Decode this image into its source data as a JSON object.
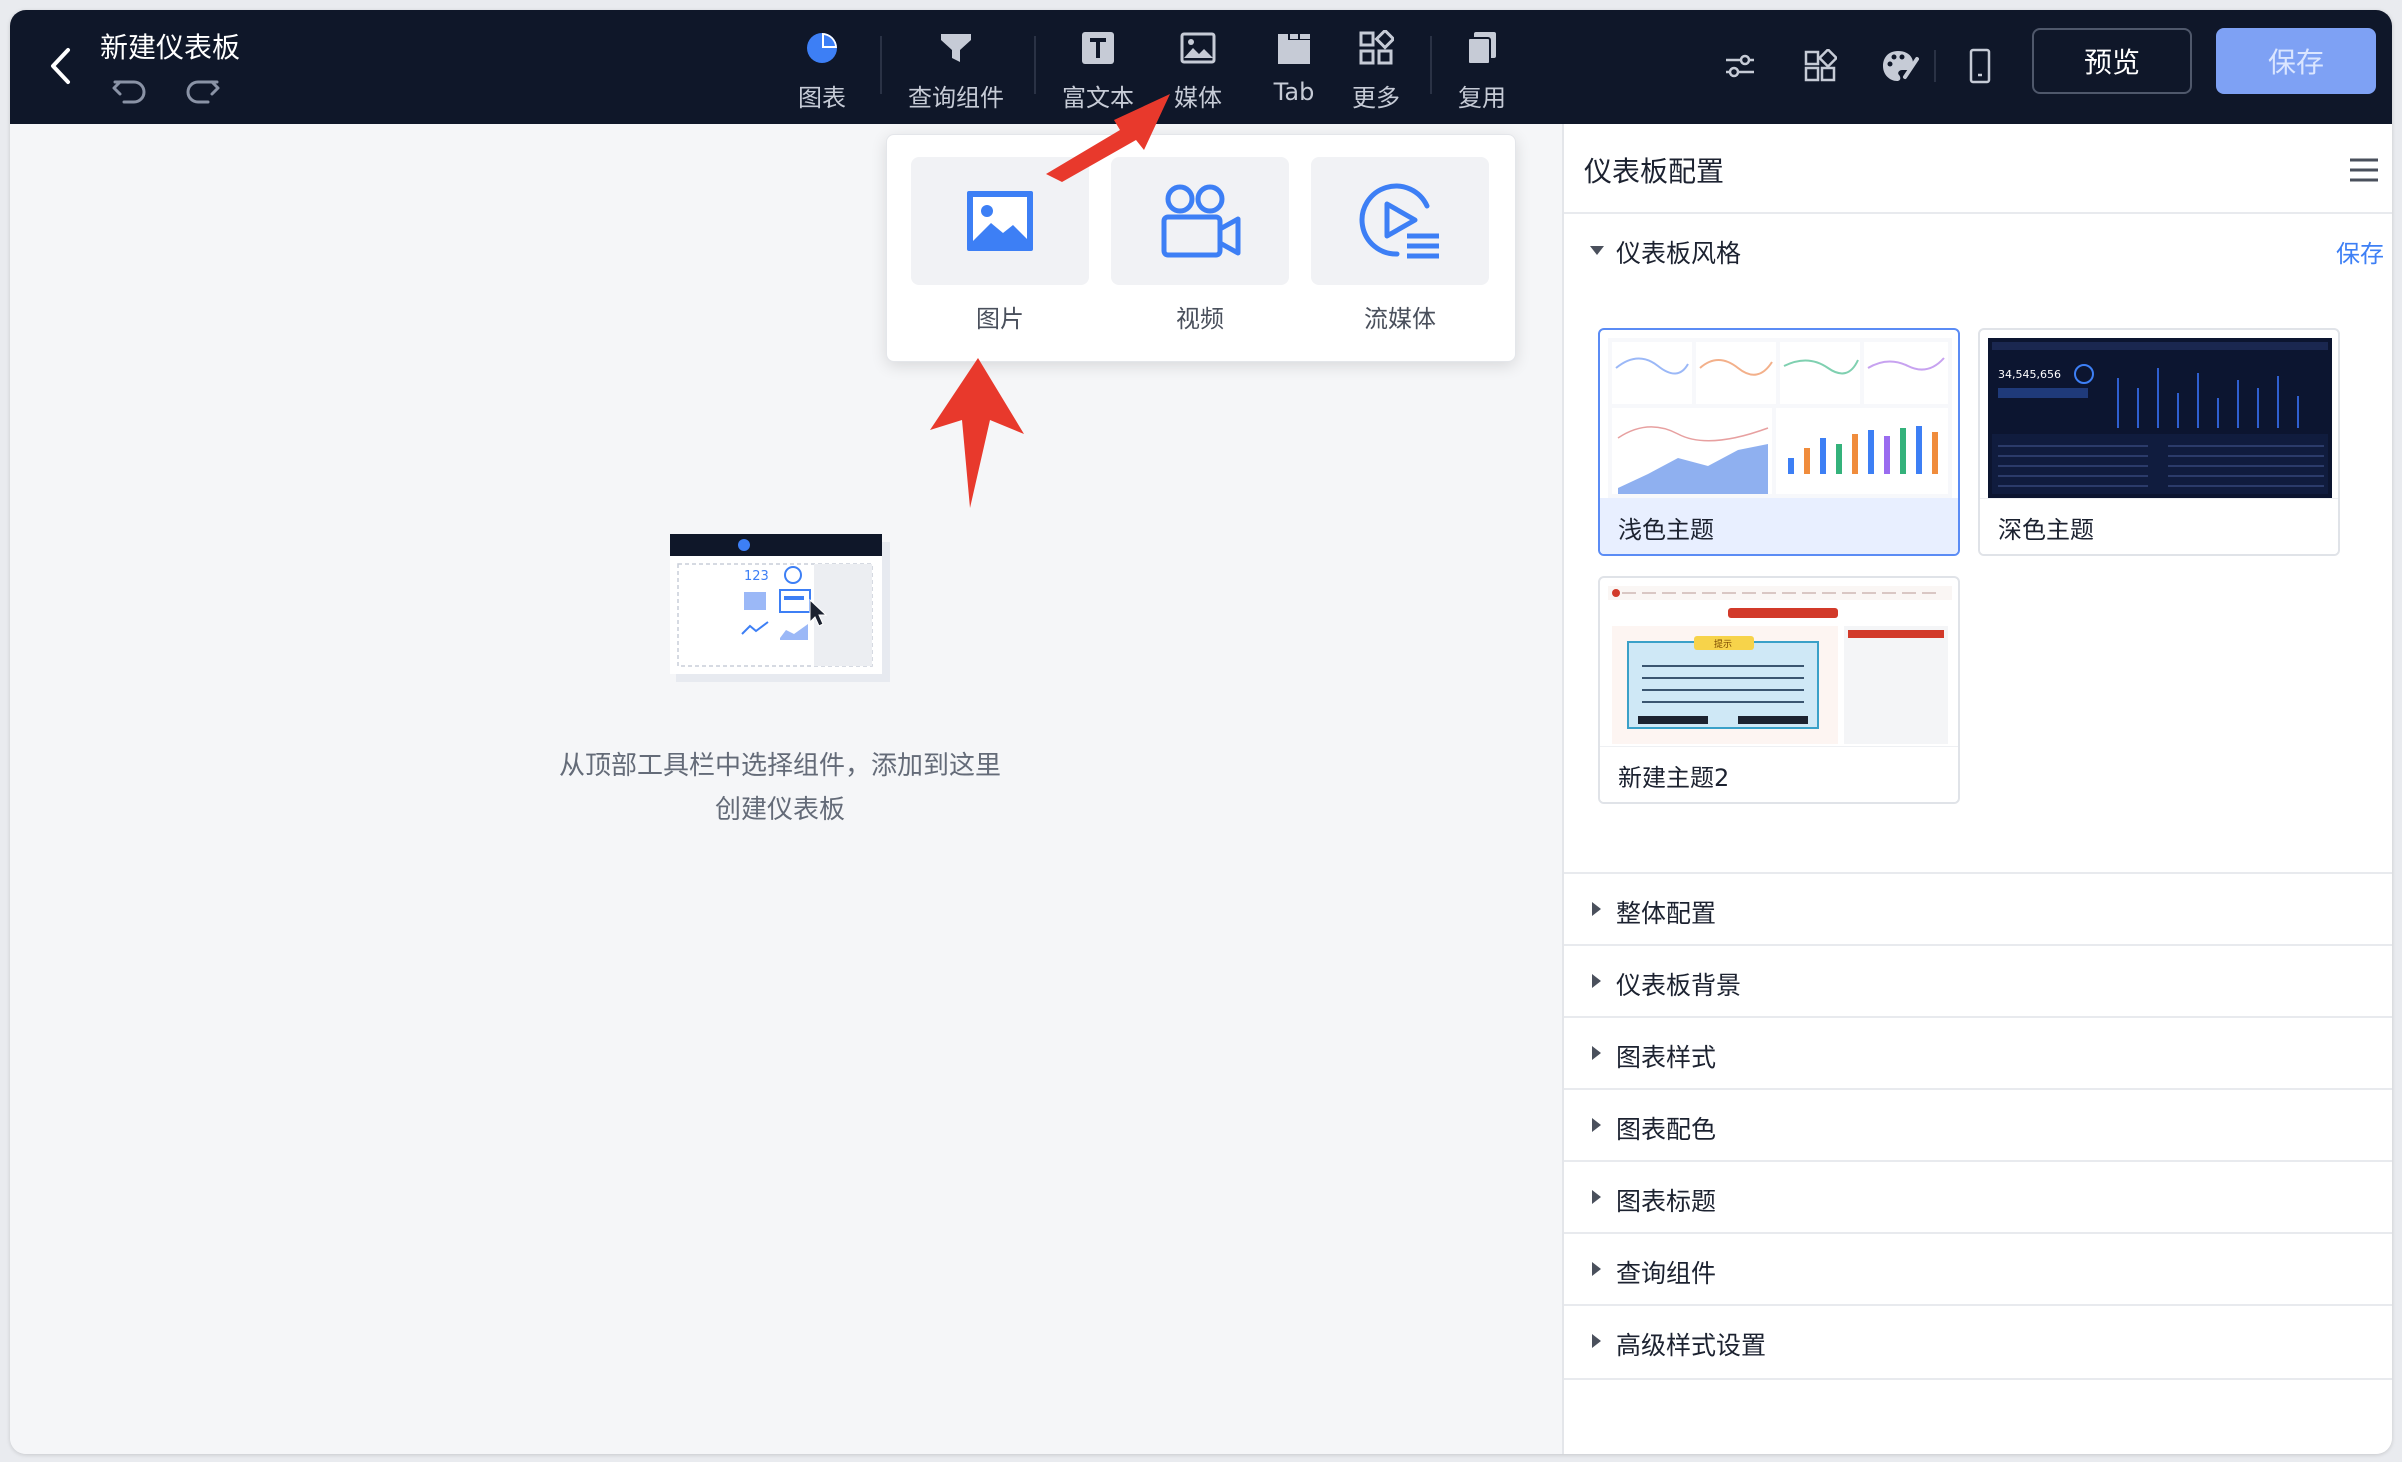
{
  "header": {
    "title": "新建仪表板",
    "toolbar": [
      {
        "label": "图表",
        "icon": "pie-chart-icon"
      },
      {
        "label": "查询组件",
        "icon": "filter-icon"
      },
      {
        "label": "富文本",
        "icon": "text-icon"
      },
      {
        "label": "媒体",
        "icon": "image-icon"
      },
      {
        "label": "Tab",
        "icon": "tab-icon"
      },
      {
        "label": "更多",
        "icon": "grid-icon"
      },
      {
        "label": "复用",
        "icon": "copy-icon"
      }
    ],
    "preview_label": "预览",
    "save_label": "保存"
  },
  "canvas": {
    "empty_line1": "从顶部工具栏中选择组件，添加到这里",
    "empty_line2": "创建仪表板",
    "illustration_text": "123"
  },
  "media_menu": {
    "items": [
      {
        "label": "图片",
        "icon": "picture-icon"
      },
      {
        "label": "视频",
        "icon": "video-camera-icon"
      },
      {
        "label": "流媒体",
        "icon": "stream-media-icon"
      }
    ]
  },
  "panel": {
    "title": "仪表板配置",
    "style_section": {
      "title": "仪表板风格",
      "save_label": "保存",
      "themes": [
        {
          "label": "浅色主题",
          "selected": true
        },
        {
          "label": "深色主题",
          "selected": false
        },
        {
          "label": "新建主题2",
          "selected": false
        }
      ],
      "dark_thumb_number": "34,545,656",
      "custom_thumb_banner": "提示"
    },
    "accordions": [
      "整体配置",
      "仪表板背景",
      "图表样式",
      "图表配色",
      "图表标题",
      "查询组件",
      "高级样式设置"
    ]
  },
  "colors": {
    "topbar_bg": "#0f1729",
    "accent": "#3d7ff5",
    "save_btn": "#7ea1f4",
    "arrow_red": "#e8392c"
  }
}
